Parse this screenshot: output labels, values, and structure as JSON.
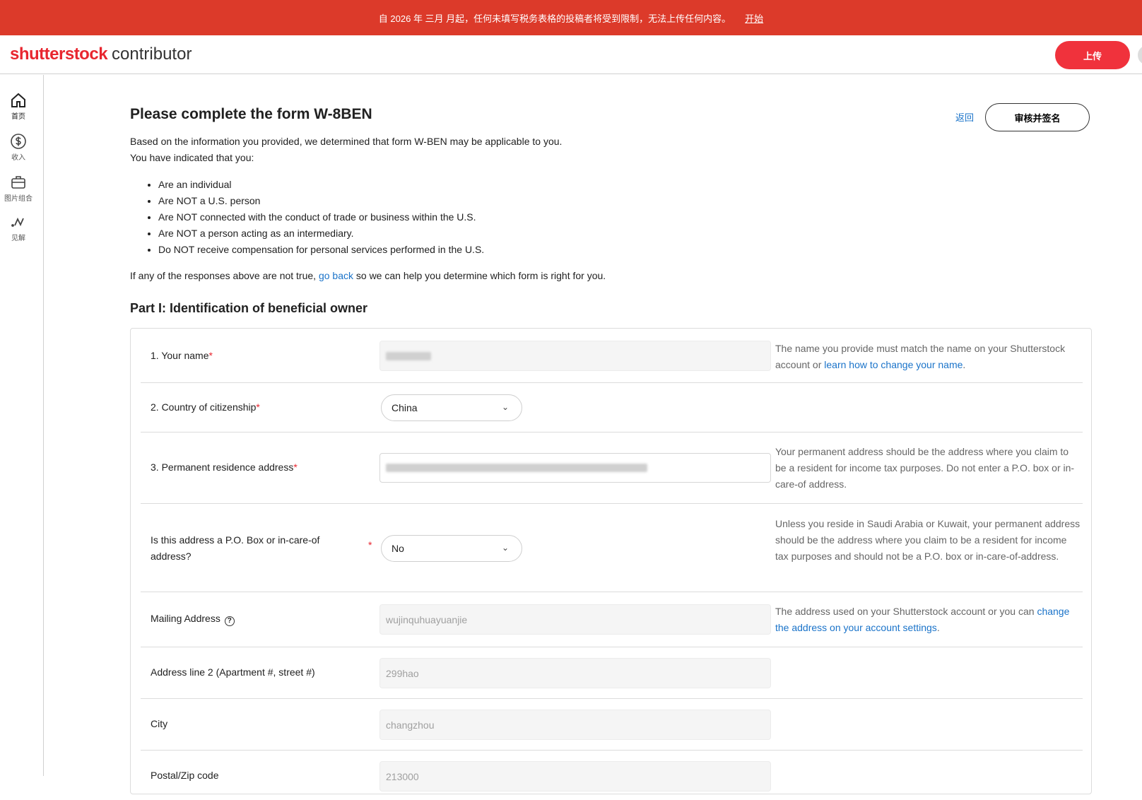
{
  "banner": {
    "message": "自 2026 年 三月 月起，任何未填写税务表格的投稿者将受到限制，无法上传任何内容。",
    "action": "开始"
  },
  "header": {
    "logo_brand": "shutterstock",
    "logo_sub": "contributor",
    "upload_label": "上传",
    "brand_color": "#e8262f"
  },
  "sidebar": {
    "items": [
      {
        "label": "首页",
        "icon": "home-icon"
      },
      {
        "label": "收入",
        "icon": "dollar-icon"
      },
      {
        "label": "图片组合",
        "icon": "briefcase-icon"
      },
      {
        "label": "见解",
        "icon": "insights-icon"
      }
    ]
  },
  "page": {
    "title": "Please complete the form W-8BEN",
    "back_label": "返回",
    "review_label": "审核并签名",
    "intro_line1": "Based on the information you provided, we determined that form W-BEN may be applicable to you.",
    "intro_line2": "You have indicated that you:",
    "bullets": [
      "Are an individual",
      "Are NOT a U.S. person",
      "Are NOT connected with the conduct of trade or business within the U.S.",
      "Are NOT a person acting as an intermediary.",
      "Do NOT receive compensation for personal services performed in the U.S."
    ],
    "if_prefix": "If any of the responses above are not true, ",
    "go_back": "go back",
    "if_suffix": " so we can help you determine which form is right for you.",
    "part_title": "Part I: Identification of beneficial owner"
  },
  "form": {
    "name": {
      "label": "1. Your name",
      "help_prefix": "The name you provide must match the name on your Shutterstock account or ",
      "help_link": "learn how to change your name",
      "help_suffix": "."
    },
    "citizenship": {
      "label": "2. Country of citizenship",
      "value": "China"
    },
    "residence": {
      "label": "3. Permanent residence address",
      "help": "Your permanent address should be the address where you claim to be a resident for income tax purposes. Do not enter a P.O. box or in-care-of address."
    },
    "po_box": {
      "label": "Is this address a P.O. Box or in-care-of address?",
      "value": "No",
      "help": "Unless you reside in Saudi Arabia or Kuwait, your permanent address should be the address where you claim to be a resident for income tax purposes and should not be a P.O. box or in-care-of-address."
    },
    "mailing": {
      "label": "Mailing Address",
      "value": "wujinquhuayuanjie",
      "help_prefix": "The address used on your Shutterstock account or you can ",
      "help_link": "change the address on your account settings",
      "help_suffix": "."
    },
    "address2": {
      "label": "Address line 2 (Apartment #, street #)",
      "value": "299hao"
    },
    "city": {
      "label": "City",
      "value": "changzhou"
    },
    "postal": {
      "label": "Postal/Zip code",
      "value": "213000"
    }
  }
}
